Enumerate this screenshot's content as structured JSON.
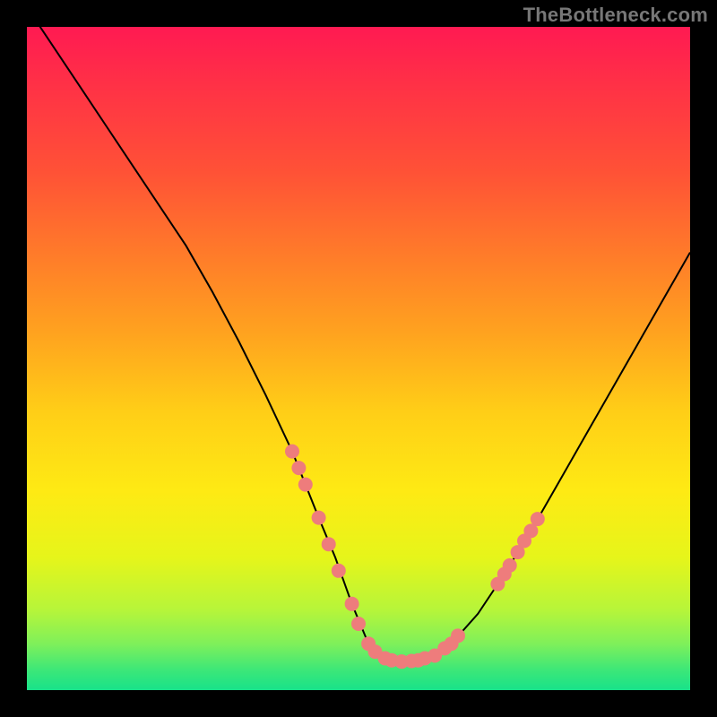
{
  "watermark": "TheBottleneck.com",
  "chart_data": {
    "type": "line",
    "title": "",
    "xlabel": "",
    "ylabel": "",
    "xlim": [
      0,
      100
    ],
    "ylim": [
      0,
      100
    ],
    "series": [
      {
        "name": "curve",
        "x": [
          0,
          4,
          8,
          12,
          16,
          20,
          24,
          28,
          32,
          36,
          40,
          44,
          46.5,
          49,
          51.5,
          54,
          56.5,
          59,
          61.5,
          64,
          68,
          72,
          76,
          80,
          84,
          88,
          92,
          96,
          100
        ],
        "y": [
          103,
          97,
          91,
          85,
          79,
          73,
          67,
          60,
          52.5,
          44.5,
          36,
          26,
          20,
          13,
          7,
          4.8,
          4.3,
          4.5,
          5.2,
          7,
          11.5,
          17.5,
          24,
          31,
          38,
          45,
          52,
          59,
          66
        ]
      }
    ],
    "markers": {
      "name": "highlighted-points",
      "color": "#ee7c7c",
      "points": [
        {
          "x": 40.0,
          "y": 36.0
        },
        {
          "x": 41.0,
          "y": 33.5
        },
        {
          "x": 42.0,
          "y": 31.0
        },
        {
          "x": 44.0,
          "y": 26.0
        },
        {
          "x": 45.5,
          "y": 22.0
        },
        {
          "x": 47.0,
          "y": 18.0
        },
        {
          "x": 49.0,
          "y": 13.0
        },
        {
          "x": 50.0,
          "y": 10.0
        },
        {
          "x": 51.5,
          "y": 7.0
        },
        {
          "x": 52.5,
          "y": 5.8
        },
        {
          "x": 54.0,
          "y": 4.8
        },
        {
          "x": 55.0,
          "y": 4.5
        },
        {
          "x": 56.5,
          "y": 4.3
        },
        {
          "x": 58.0,
          "y": 4.4
        },
        {
          "x": 59.0,
          "y": 4.5
        },
        {
          "x": 60.0,
          "y": 4.8
        },
        {
          "x": 61.5,
          "y": 5.2
        },
        {
          "x": 63.0,
          "y": 6.3
        },
        {
          "x": 64.0,
          "y": 7.0
        },
        {
          "x": 65.0,
          "y": 8.2
        },
        {
          "x": 71.0,
          "y": 16.0
        },
        {
          "x": 72.0,
          "y": 17.5
        },
        {
          "x": 72.8,
          "y": 18.8
        },
        {
          "x": 74.0,
          "y": 20.8
        },
        {
          "x": 75.0,
          "y": 22.5
        },
        {
          "x": 76.0,
          "y": 24.0
        },
        {
          "x": 77.0,
          "y": 25.8
        }
      ]
    },
    "gradient_stops": [
      {
        "pos": 0,
        "color": "#ff1a52"
      },
      {
        "pos": 22,
        "color": "#ff5236"
      },
      {
        "pos": 46,
        "color": "#ffa21f"
      },
      {
        "pos": 70,
        "color": "#feea14"
      },
      {
        "pos": 88,
        "color": "#b6f53a"
      },
      {
        "pos": 100,
        "color": "#18e28a"
      }
    ]
  }
}
